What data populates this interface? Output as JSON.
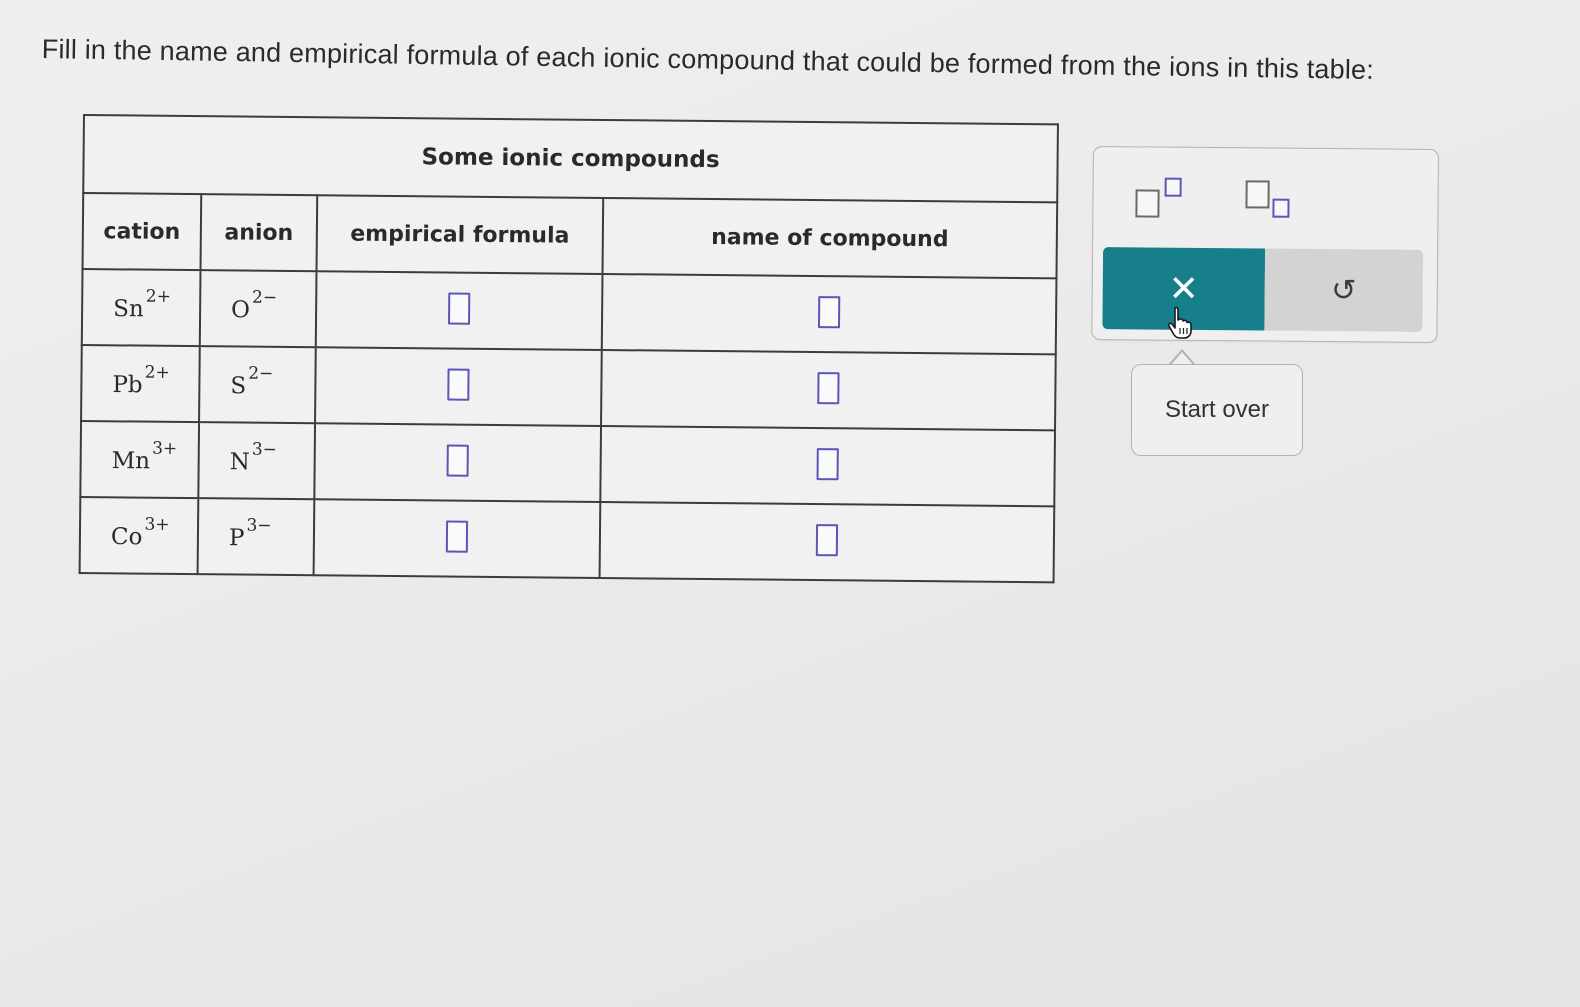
{
  "instruction": "Fill in the name and empirical formula of each ionic compound that could be formed from the ions in this table:",
  "table": {
    "caption": "Some ionic compounds",
    "headers": {
      "cation": "cation",
      "anion": "anion",
      "formula": "empirical formula",
      "name": "name of compound"
    },
    "rows": [
      {
        "cation": "Sn",
        "cation_charge": "2+",
        "anion": "O",
        "anion_charge": "2−",
        "formula": "",
        "name": ""
      },
      {
        "cation": "Pb",
        "cation_charge": "2+",
        "anion": "S",
        "anion_charge": "2−",
        "formula": "",
        "name": ""
      },
      {
        "cation": "Mn",
        "cation_charge": "3+",
        "anion": "N",
        "anion_charge": "3−",
        "formula": "",
        "name": ""
      },
      {
        "cation": "Co",
        "cation_charge": "3+",
        "anion": "P",
        "anion_charge": "3−",
        "formula": "",
        "name": ""
      }
    ]
  },
  "tools": {
    "clear_symbol": "✕",
    "undo_symbol": "↺",
    "superscript_tool": "superscript-icon",
    "subscript_tool": "subscript-icon"
  },
  "tooltip": {
    "text": "Start over"
  },
  "colors": {
    "accent": "#167f8b",
    "input_border": "#5a57b8"
  }
}
